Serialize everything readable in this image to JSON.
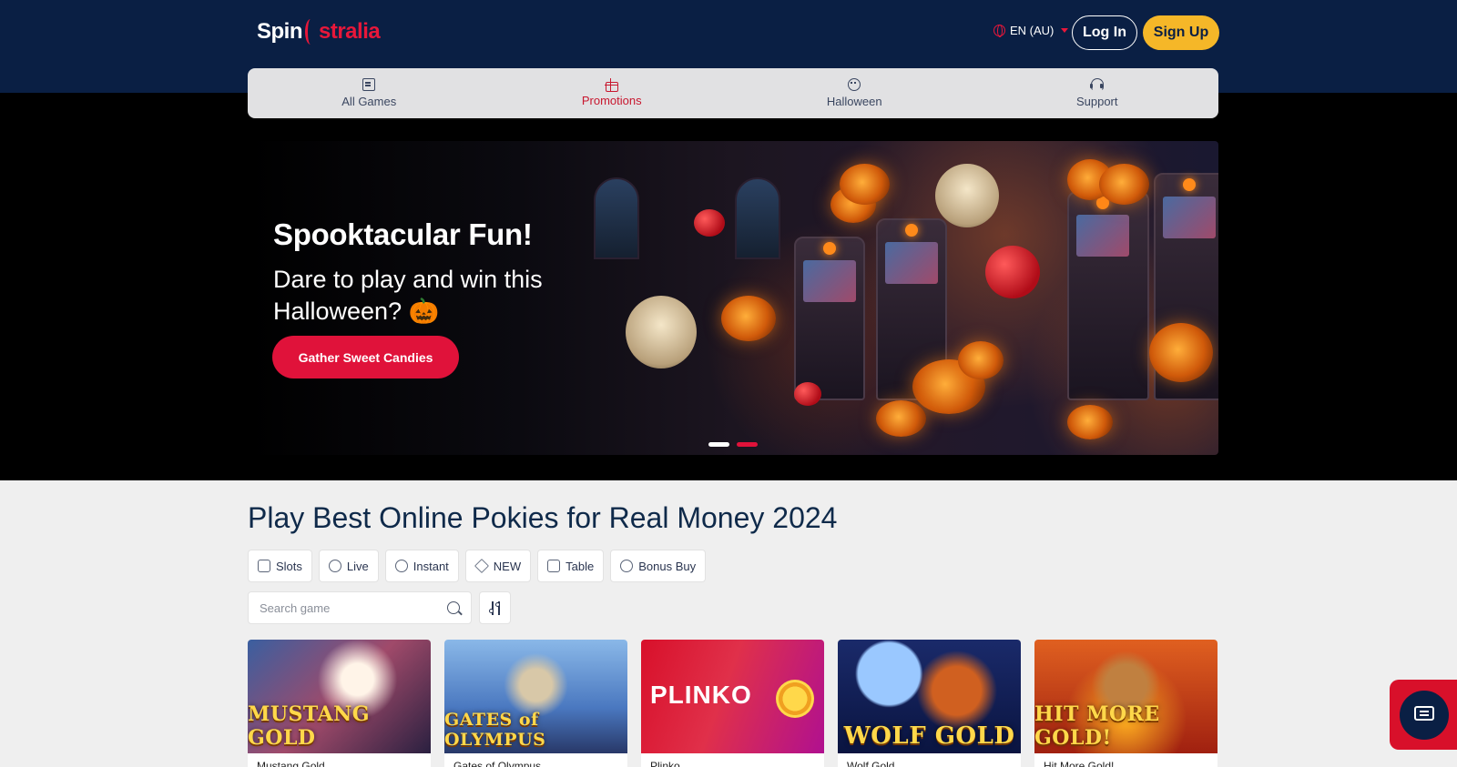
{
  "header": {
    "logo": {
      "part1": "Spin",
      "part2": "stralia"
    },
    "language": "EN (AU)",
    "login_label": "Log In",
    "signup_label": "Sign Up"
  },
  "nav": {
    "items": [
      {
        "label": "All Games",
        "icon": "games-icon"
      },
      {
        "label": "Promotions",
        "icon": "gift-icon"
      },
      {
        "label": "Halloween",
        "icon": "pumpkin-icon"
      },
      {
        "label": "Support",
        "icon": "headset-icon"
      }
    ]
  },
  "hero": {
    "title": "Spooktacular Fun!",
    "subtitle": "Dare to play and win this Halloween? 🎃",
    "cta_label": "Gather Sweet Candies",
    "slide_count": 2,
    "active_slide": 2
  },
  "section": {
    "title": "Play Best Online Pokies for Real Money 2024"
  },
  "filters": [
    {
      "label": "Slots",
      "icon": "slots-icon"
    },
    {
      "label": "Live",
      "icon": "live-icon"
    },
    {
      "label": "Instant",
      "icon": "lightning-icon"
    },
    {
      "label": "NEW",
      "icon": "diamond-icon"
    },
    {
      "label": "Table",
      "icon": "cards-icon"
    },
    {
      "label": "Bonus Buy",
      "icon": "coins-icon"
    }
  ],
  "search": {
    "placeholder": "Search game"
  },
  "games": [
    {
      "art_text": "MUSTANG GOLD",
      "name": "Mustang Gold"
    },
    {
      "art_text": "GATES of OLYMPUS",
      "name": "Gates of Olympus"
    },
    {
      "art_text": "PLINKO",
      "name": "Plinko"
    },
    {
      "art_text": "WOLF GOLD",
      "name": "Wolf Gold"
    },
    {
      "art_text": "HIT MORE GOLD!",
      "name": "Hit More Gold!"
    }
  ],
  "colors": {
    "header_bg": "#0a1f44",
    "accent_red": "#e0123a",
    "signup_yellow": "#f5b728"
  }
}
